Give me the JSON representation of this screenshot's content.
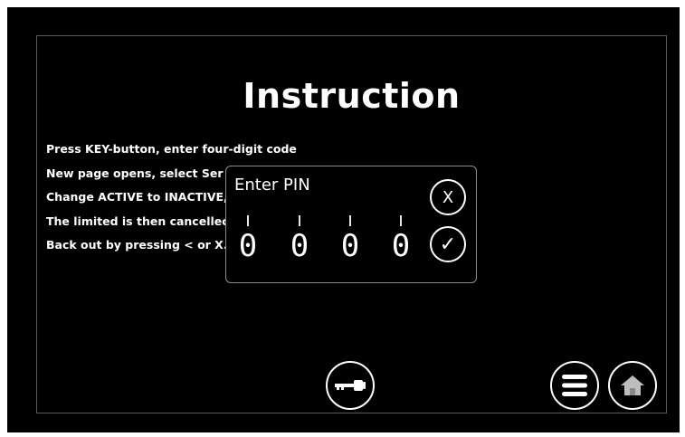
{
  "screen": {
    "title": "Instruction",
    "instructions": [
      "Press KEY-button, enter four-digit code",
      "New page opens, select Ser",
      "Change ACTIVE to INACTIVE,",
      "The limited is then cancellec",
      "Back out by pressing < or X."
    ]
  },
  "pin_dialog": {
    "title": "Enter PIN",
    "digits": [
      "0",
      "0",
      "0",
      "0"
    ],
    "close_label": "X",
    "confirm_label": "✓"
  },
  "toolbar": {
    "icons": [
      "key-icon",
      "menu-icon",
      "home-icon"
    ]
  },
  "colors": {
    "background": "#000000",
    "foreground": "#ffffff",
    "border": "#8a8a8a"
  }
}
